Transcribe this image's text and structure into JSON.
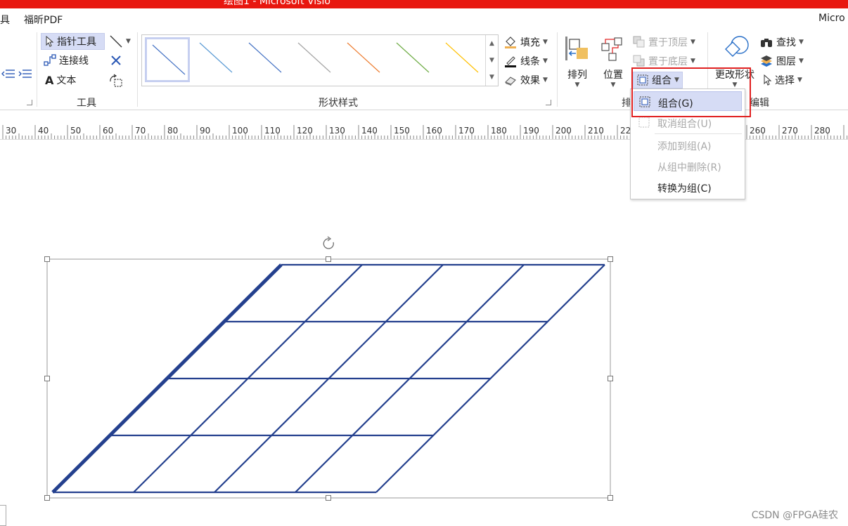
{
  "title_bar": {
    "text": "绘图1 - Microsoft Visio",
    "color": "#e8170f"
  },
  "tabs": {
    "partial_left": "具",
    "foxit": "福昕PDF",
    "right_partial": "Micro"
  },
  "tools_group": {
    "pointer": "指针工具",
    "connector": "连接线",
    "text": "文本",
    "label": "工具"
  },
  "shape_styles": {
    "label": "形状样式",
    "swatch_colors": [
      "#4472c4",
      "#5b9bd5",
      "#4472c4",
      "#a5a5a5",
      "#ed7d31",
      "#70ad47",
      "#ffc000"
    ]
  },
  "format": {
    "fill": "填充",
    "line": "线条",
    "effects": "效果"
  },
  "arrange": {
    "arrange_btn": "排列",
    "position_btn": "位置",
    "bring_front": "置于顶层",
    "send_back": "置于底层",
    "group_btn": "组合",
    "label": "排"
  },
  "editing": {
    "change_shape": "更改形状",
    "find": "查找",
    "layers": "图层",
    "select": "选择",
    "label": "编辑"
  },
  "ruler": {
    "labels": [
      "30",
      "40",
      "50",
      "60",
      "70",
      "80",
      "90",
      "100",
      "110",
      "120",
      "130",
      "140",
      "150",
      "160",
      "170",
      "180",
      "190",
      "200",
      "210",
      "22",
      "260",
      "270",
      "280"
    ]
  },
  "dropdown": {
    "items": [
      {
        "label": "组合(G)",
        "enabled": true,
        "highlighted": true
      },
      {
        "label": "取消组合(U)",
        "enabled": false
      },
      {
        "label": "添加到组(A)",
        "enabled": false
      },
      {
        "label": "从组中删除(R)",
        "enabled": false
      },
      {
        "label": "转换为组(C)",
        "enabled": true
      }
    ]
  },
  "drawing": {
    "line_color": "#24408e",
    "rows": 4,
    "cols": 4
  },
  "watermark": "CSDN @FPGA硅农",
  "highlight_color": "#e02020"
}
